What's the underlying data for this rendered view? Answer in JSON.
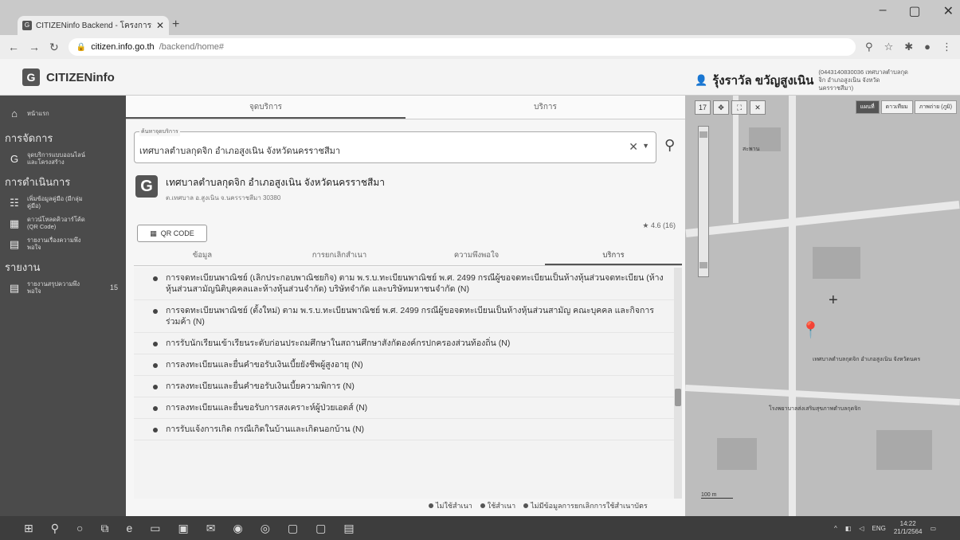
{
  "browser": {
    "tab_title": "CITIZENinfo Backend - โครงการกา",
    "url_host": "citizen.info.go.th",
    "url_path": "/backend/home#"
  },
  "header": {
    "logo_text": "CITIZENinfo",
    "user_name": "รุ้งราวัล ขวัญสูงเนิน",
    "user_org": "(0443140830036 เทศบาลตำบลกุดจิก อำเภอสูงเนิน จังหวัดนครราชสีมา)"
  },
  "sidebar": {
    "home": "หน้าแรก",
    "section1": "การจัดการ",
    "item1": "จุดบริการแบบออนไลน์และโครงสร้าง",
    "section2": "การดำเนินการ",
    "item2": "เพิ่มข้อมูลคู่มือ (มีกลุ่มคู่มือ)",
    "item3": "ดาวน์โหลดคิวอาร์โค้ด (QR Code)",
    "item4": "รายงานเรื่องความพึงพอใจ",
    "section3": "รายงาน",
    "item5": "รายงานสรุปความพึงพอใจ",
    "item5_count": "15"
  },
  "main": {
    "tab1": "จุดบริการ",
    "tab2": "บริการ",
    "search_legend": "ค้นหาจุดบริการ",
    "search_value": "เทศบาลตำบลกุดจิก อำเภอสูงเนิน จังหวัดนครราชสีมา",
    "org_name": "เทศบาลตำบลกุดจิก อำเภอสูงเนิน จังหวัดนครราชสีมา",
    "org_addr": "ต.เทศบาล อ.สูงเนิน จ.นครราชสีมา 30380",
    "qr_label": "QR CODE",
    "rating": "4.6 (16)",
    "subtab1": "ข้อมูล",
    "subtab2": "การยกเลิกสำเนา",
    "subtab3": "ความพึงพอใจ",
    "subtab4": "บริการ",
    "services": [
      "การจดทะเบียนพาณิชย์ (เลิกประกอบพาณิชยกิจ) ตาม พ.ร.บ.ทะเบียนพาณิชย์ พ.ศ. 2499 กรณีผู้ขอจดทะเบียนเป็นห้างหุ้นส่วนจดทะเบียน (ห้างหุ้นส่วนสามัญนิติบุคคลและห้างหุ้นส่วนจำกัด) บริษัทจำกัด และบริษัทมหาชนจำกัด (N)",
      "การจดทะเบียนพาณิชย์ (ตั้งใหม่) ตาม พ.ร.บ.ทะเบียนพาณิชย์ พ.ศ. 2499 กรณีผู้ขอจดทะเบียนเป็นห้างหุ้นส่วนสามัญ คณะบุคคล และกิจการร่วมค้า (N)",
      "การรับนักเรียนเข้าเรียนระดับก่อนประถมศึกษาในสถานศึกษาสังกัดองค์กรปกครองส่วนท้องถิ่น (N)",
      "การลงทะเบียนและยื่นคำขอรับเงินเบี้ยยังชีพผู้สูงอายุ (N)",
      "การลงทะเบียนและยื่นคำขอรับเงินเบี้ยความพิการ (N)",
      "การลงทะเบียนและยื่นขอรับการสงเคราะห์ผู้ป่วยเอดส์ (N)",
      "การรับแจ้งการเกิด กรณีเกิดในบ้านและเกิดนอกบ้าน (N)"
    ],
    "legend1": "ไม่ใช้สำเนา",
    "legend2": "ใช้สำเนา",
    "legend3": "ไม่มีข้อมูลการยกเลิกการใช้สำเนาบัตร"
  },
  "map": {
    "type_map": "แผนที่",
    "type_sat": "ดาวเทียม",
    "type_terrain": "ภาพถ่าย (ภูมิ)",
    "zoom_label": "17",
    "place1": "เทศบาลตำบลกุดจิก อำเภอสูงเนิน จังหวัดนคร",
    "place2": "โรงพยาบาลส่งเสริมสุขภาพตำบลกุดจิก",
    "place3": "สะพาน",
    "scale": "100 m"
  },
  "taskbar": {
    "lang": "ENG",
    "time": "14:22",
    "date": "21/1/2564"
  }
}
